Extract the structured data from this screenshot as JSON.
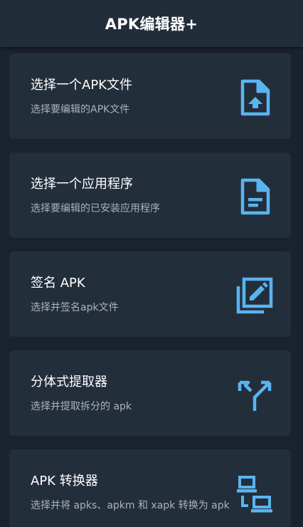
{
  "appbar": {
    "title": "APK编辑器+"
  },
  "cards": [
    {
      "title": "选择一个APK文件",
      "subtitle": "选择要编辑的APK文件",
      "icon": "file-upload-icon"
    },
    {
      "title": "选择一个应用程序",
      "subtitle": "选择要编辑的已安装应用程序",
      "icon": "document-icon"
    },
    {
      "title": "签名 APK",
      "subtitle": "选择并签名apk文件",
      "icon": "edit-sign-icon"
    },
    {
      "title": "分体式提取器",
      "subtitle": "选择并提取拆分的 apk",
      "icon": "call-split-icon"
    },
    {
      "title": "APK 转换器",
      "subtitle": "选择并将 apks、apkm 和 xapk 转换为 apk",
      "icon": "convert-network-icon"
    }
  ],
  "colors": {
    "accent": "#5ab4f0",
    "card": "#232e3b",
    "background": "#1a222d",
    "appbar": "#222d3a"
  }
}
